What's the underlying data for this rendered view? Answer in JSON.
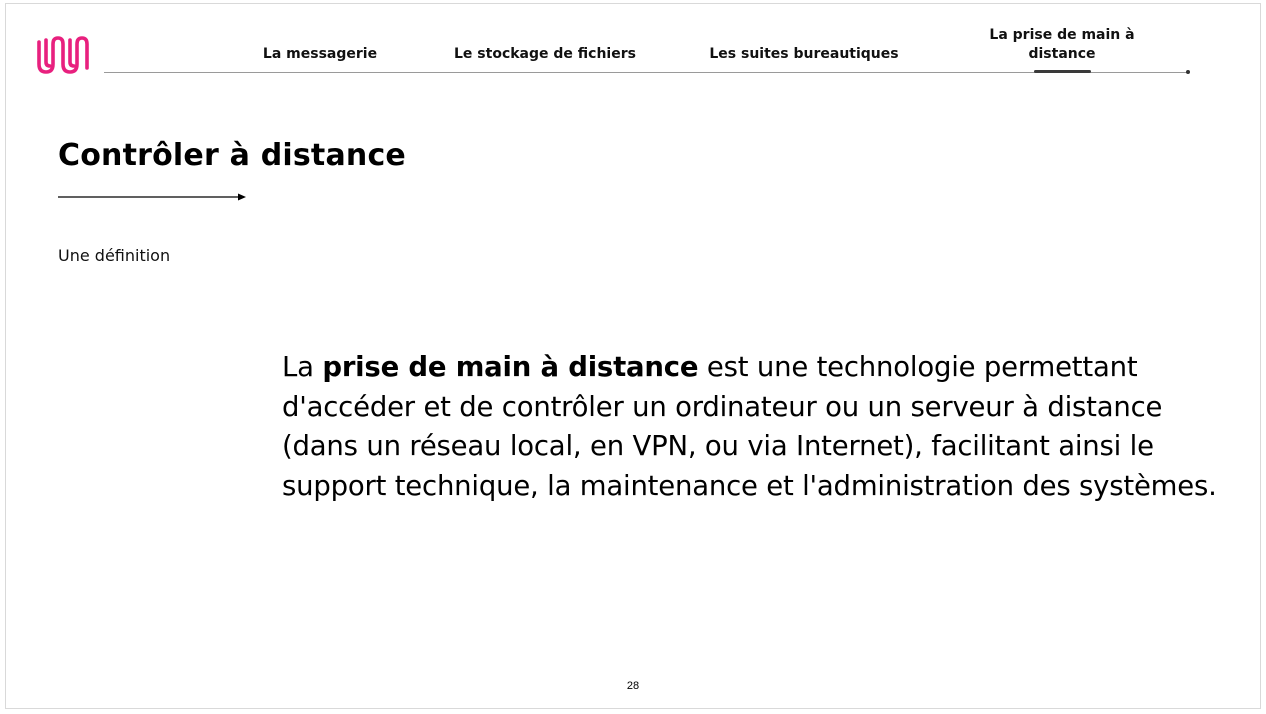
{
  "nav": {
    "tabs": [
      {
        "label": "La messagerie"
      },
      {
        "label": "Le stockage de fichiers"
      },
      {
        "label": "Les suites bureautiques"
      },
      {
        "label": "La prise de main à distance",
        "active": true
      }
    ]
  },
  "slide": {
    "title": "Contrôler à distance",
    "subtitle": "Une définition",
    "definition": {
      "before": "La ",
      "bold": "prise de main à distance",
      "after": " est une technologie permettant d'accéder et de contrôler un ordinateur ou un serveur à distance (dans un réseau local, en VPN, ou via Internet), facilitant ainsi le support technique, la maintenance et l'administration des systèmes."
    },
    "page_number": "28"
  },
  "colors": {
    "logo": "#e8207e",
    "nav_line": "#9a9a9a",
    "active_underline": "#3a3a3a",
    "border": "#d9d9d9"
  },
  "icons": {
    "logo": "wave-logo-icon",
    "arrow": "arrow-right-icon"
  }
}
